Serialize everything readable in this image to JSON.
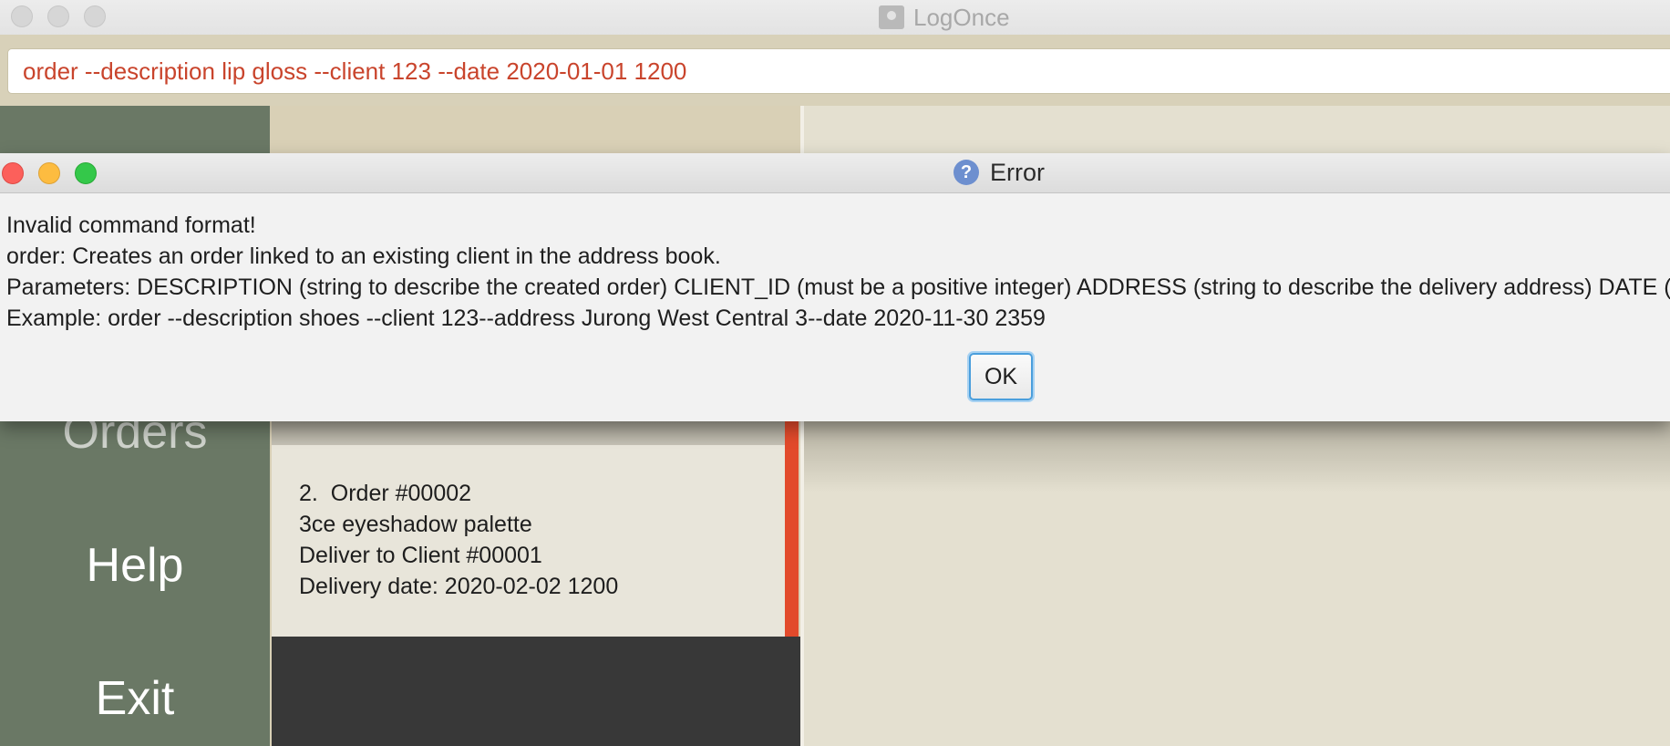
{
  "window": {
    "title": "LogOnce",
    "app_icon": "contact-book-icon"
  },
  "command_box": {
    "value": "order --description lip gloss --client 123 --date 2020-01-01 1200"
  },
  "sidebar": {
    "items": [
      {
        "label": "Orders"
      },
      {
        "label": "Help"
      },
      {
        "label": "Exit"
      }
    ]
  },
  "order_card": {
    "index": "2.",
    "title": "Order #00002",
    "description": "3ce eyeshadow palette",
    "client": "Deliver to Client #00001",
    "date": "Delivery date: 2020-02-02 1200"
  },
  "dialog": {
    "title": "Error",
    "icon": "question-icon",
    "message_lines": [
      "Invalid command format!",
      "order: Creates an order linked to an existing client in the address book.",
      "Parameters: DESCRIPTION (string to describe the created order) CLIENT_ID (must be a positive integer) ADDRESS (string to describe the delivery address) DATE (date of",
      "Example: order --description shoes --client 123--address Jurong West Central 3--date 2020-11-30 2359"
    ],
    "ok_label": "OK"
  },
  "colors": {
    "sidebar": "#6a7865",
    "command_text": "#c9442c",
    "accent": "#e24a2b",
    "ok_focus": "#4a9edc"
  }
}
